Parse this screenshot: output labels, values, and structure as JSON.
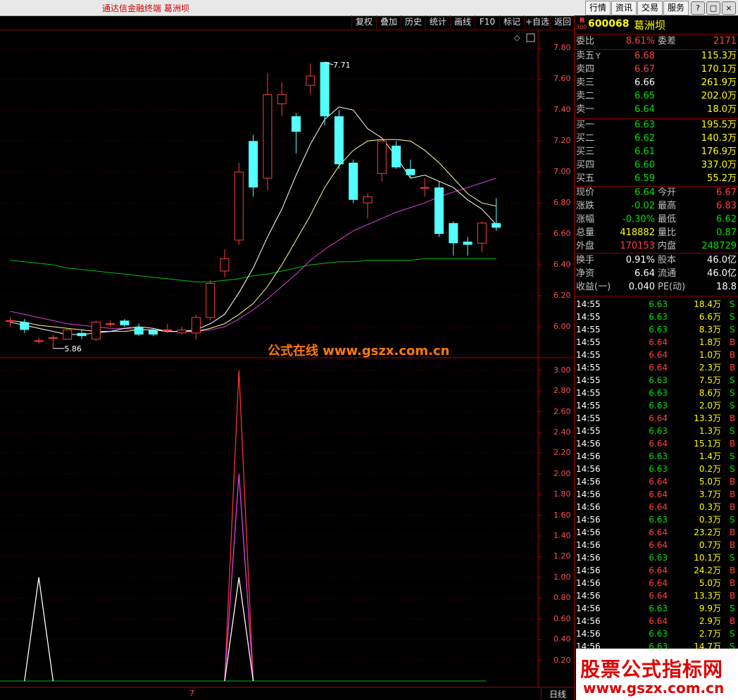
{
  "app": {
    "title": "通达信金融终端  葛洲坝"
  },
  "top_buttons": [
    "行情",
    "资讯",
    "交易",
    "服务"
  ],
  "window_buttons": [
    "?",
    "□",
    "×"
  ],
  "toolbar": [
    "复权",
    "叠加",
    "历史",
    "统计",
    "画线",
    "F10",
    "标记",
    "+自选",
    "返回"
  ],
  "watermark": "公式在线  www.gszx.com.cn",
  "logo": {
    "cn": "股票公式指标网",
    "url": "www.gszx.com.cn"
  },
  "bottom": {
    "period_label": "日线",
    "date_marker": "7"
  },
  "stock": {
    "r_badge": "R",
    "r_sub": "300",
    "code": "600068",
    "name": "葛洲坝"
  },
  "weibi": {
    "label1": "委比",
    "value1": "8.61%",
    "label2": "委差",
    "value2": "2171"
  },
  "sell_orders": [
    {
      "label": "卖五",
      "flag": "Y",
      "price": "6.68",
      "vol": "115.3万"
    },
    {
      "label": "卖四",
      "flag": "",
      "price": "6.67",
      "vol": "170.1万"
    },
    {
      "label": "卖三",
      "flag": "",
      "price": "6.66",
      "vol": "261.9万"
    },
    {
      "label": "卖二",
      "flag": "",
      "price": "6.65",
      "vol": "202.0万"
    },
    {
      "label": "卖一",
      "flag": "",
      "price": "6.64",
      "vol": "18.0万"
    }
  ],
  "buy_orders": [
    {
      "label": "买一",
      "price": "6.63",
      "vol": "195.5万"
    },
    {
      "label": "买二",
      "price": "6.62",
      "vol": "140.3万"
    },
    {
      "label": "买三",
      "price": "6.61",
      "vol": "176.9万"
    },
    {
      "label": "买四",
      "price": "6.60",
      "vol": "337.0万"
    },
    {
      "label": "买五",
      "price": "6.59",
      "vol": "55.2万"
    }
  ],
  "stats": [
    {
      "l1": "现价",
      "v1": "6.64",
      "c1": "green",
      "l2": "今开",
      "v2": "6.67",
      "c2": "red"
    },
    {
      "l1": "涨跌",
      "v1": "-0.02",
      "c1": "green",
      "l2": "最高",
      "v2": "6.83",
      "c2": "red"
    },
    {
      "l1": "涨幅",
      "v1": "-0.30%",
      "c1": "green",
      "l2": "最低",
      "v2": "6.62",
      "c2": "green"
    },
    {
      "l1": "总量",
      "v1": "418882",
      "c1": "yellow",
      "l2": "量比",
      "v2": "0.87",
      "c2": "green"
    },
    {
      "l1": "外盘",
      "v1": "170153",
      "c1": "red",
      "l2": "内盘",
      "v2": "248729",
      "c2": "green"
    }
  ],
  "finance": [
    {
      "l1": "换手",
      "v1": "0.91%",
      "l2": "股本",
      "v2": "46.0亿"
    },
    {
      "l1": "净资",
      "v1": "6.64",
      "l2": "流通",
      "v2": "46.0亿"
    },
    {
      "l1": "收益(一)",
      "v1": "0.040",
      "l2": "PE(动)",
      "v2": "18.8"
    }
  ],
  "ticks": [
    {
      "t": "14:55",
      "p": "6.63",
      "v": "18.4万",
      "s": "S"
    },
    {
      "t": "14:55",
      "p": "6.63",
      "v": "6.6万",
      "s": "S"
    },
    {
      "t": "14:55",
      "p": "6.63",
      "v": "8.3万",
      "s": "S"
    },
    {
      "t": "14:55",
      "p": "6.64",
      "v": "1.8万",
      "s": "B"
    },
    {
      "t": "14:55",
      "p": "6.64",
      "v": "1.0万",
      "s": "B"
    },
    {
      "t": "14:55",
      "p": "6.64",
      "v": "2.3万",
      "s": "B"
    },
    {
      "t": "14:55",
      "p": "6.63",
      "v": "7.5万",
      "s": "S"
    },
    {
      "t": "14:55",
      "p": "6.63",
      "v": "8.6万",
      "s": "S"
    },
    {
      "t": "14:55",
      "p": "6.63",
      "v": "2.0万",
      "s": "S"
    },
    {
      "t": "14:55",
      "p": "6.64",
      "v": "13.3万",
      "s": "B"
    },
    {
      "t": "14:55",
      "p": "6.63",
      "v": "1.3万",
      "s": "S"
    },
    {
      "t": "14:56",
      "p": "6.64",
      "v": "15.1万",
      "s": "B"
    },
    {
      "t": "14:56",
      "p": "6.63",
      "v": "1.4万",
      "s": "S"
    },
    {
      "t": "14:56",
      "p": "6.63",
      "v": "0.2万",
      "s": "S"
    },
    {
      "t": "14:56",
      "p": "6.64",
      "v": "5.0万",
      "s": "B"
    },
    {
      "t": "14:56",
      "p": "6.64",
      "v": "3.7万",
      "s": "B"
    },
    {
      "t": "14:56",
      "p": "6.64",
      "v": "0.3万",
      "s": "B"
    },
    {
      "t": "14:56",
      "p": "6.63",
      "v": "0.3万",
      "s": "S"
    },
    {
      "t": "14:56",
      "p": "6.64",
      "v": "23.2万",
      "s": "B"
    },
    {
      "t": "14:56",
      "p": "6.64",
      "v": "0.7万",
      "s": "B"
    },
    {
      "t": "14:56",
      "p": "6.63",
      "v": "10.1万",
      "s": "S"
    },
    {
      "t": "14:56",
      "p": "6.64",
      "v": "24.2万",
      "s": "B"
    },
    {
      "t": "14:56",
      "p": "6.64",
      "v": "5.0万",
      "s": "B"
    },
    {
      "t": "14:56",
      "p": "6.64",
      "v": "13.3万",
      "s": "B"
    },
    {
      "t": "14:56",
      "p": "6.63",
      "v": "9.9万",
      "s": "S"
    },
    {
      "t": "14:56",
      "p": "6.64",
      "v": "2.9万",
      "s": "B"
    },
    {
      "t": "14:56",
      "p": "6.63",
      "v": "2.7万",
      "s": "S"
    },
    {
      "t": "14:56",
      "p": "6.63",
      "v": "14.7万",
      "s": "S"
    }
  ],
  "chart_data": [
    {
      "type": "candlestick",
      "y_ticks": [
        "7.80",
        "7.60",
        "7.40",
        "7.20",
        "7.00",
        "6.80",
        "6.60",
        "6.40",
        "6.20",
        "6.00"
      ],
      "ylim": [
        5.8,
        7.92
      ],
      "max_label": "7.71",
      "min_label": "5.86",
      "candles": [
        {
          "o": 6.04,
          "c": 6.04,
          "h": 6.06,
          "l": 6.0
        },
        {
          "o": 6.03,
          "c": 5.98,
          "h": 6.05,
          "l": 5.96
        },
        {
          "o": 5.91,
          "c": 5.91,
          "h": 5.93,
          "l": 5.89
        },
        {
          "o": 5.93,
          "c": 5.93,
          "h": 5.95,
          "l": 5.86
        },
        {
          "o": 5.92,
          "c": 5.98,
          "h": 5.99,
          "l": 5.92
        },
        {
          "o": 5.96,
          "c": 5.94,
          "h": 5.98,
          "l": 5.92
        },
        {
          "o": 5.92,
          "c": 6.03,
          "h": 6.04,
          "l": 5.91
        },
        {
          "o": 6.02,
          "c": 6.02,
          "h": 6.04,
          "l": 6.0
        },
        {
          "o": 6.04,
          "c": 6.01,
          "h": 6.05,
          "l": 6.0
        },
        {
          "o": 6.0,
          "c": 5.95,
          "h": 6.02,
          "l": 5.94
        },
        {
          "o": 5.98,
          "c": 5.95,
          "h": 5.99,
          "l": 5.94
        },
        {
          "o": 5.98,
          "c": 5.98,
          "h": 6.02,
          "l": 5.96
        },
        {
          "o": 5.96,
          "c": 5.98,
          "h": 6.0,
          "l": 5.95
        },
        {
          "o": 5.96,
          "c": 6.06,
          "h": 6.08,
          "l": 5.92
        },
        {
          "o": 6.06,
          "c": 6.28,
          "h": 6.3,
          "l": 6.04
        },
        {
          "o": 6.36,
          "c": 6.44,
          "h": 6.5,
          "l": 6.32
        },
        {
          "o": 6.56,
          "c": 7.0,
          "h": 7.06,
          "l": 6.53
        },
        {
          "o": 7.2,
          "c": 6.9,
          "h": 7.24,
          "l": 6.84
        },
        {
          "o": 6.96,
          "c": 7.5,
          "h": 7.64,
          "l": 6.88
        },
        {
          "o": 7.44,
          "c": 7.5,
          "h": 7.58,
          "l": 7.36
        },
        {
          "o": 7.36,
          "c": 7.26,
          "h": 7.38,
          "l": 7.12
        },
        {
          "o": 7.56,
          "c": 7.62,
          "h": 7.7,
          "l": 7.5
        },
        {
          "o": 7.71,
          "c": 7.36,
          "h": 7.71,
          "l": 7.3
        },
        {
          "o": 7.36,
          "c": 7.05,
          "h": 7.4,
          "l": 7.02
        },
        {
          "o": 7.06,
          "c": 6.82,
          "h": 7.08,
          "l": 6.8
        },
        {
          "o": 6.8,
          "c": 6.84,
          "h": 6.86,
          "l": 6.7
        },
        {
          "o": 6.99,
          "c": 7.2,
          "h": 7.22,
          "l": 6.94
        },
        {
          "o": 7.17,
          "c": 7.03,
          "h": 7.2,
          "l": 7.02
        },
        {
          "o": 7.02,
          "c": 6.98,
          "h": 7.08,
          "l": 6.96
        },
        {
          "o": 6.9,
          "c": 6.9,
          "h": 6.96,
          "l": 6.84
        },
        {
          "o": 6.9,
          "c": 6.6,
          "h": 6.94,
          "l": 6.58
        },
        {
          "o": 6.67,
          "c": 6.54,
          "h": 6.68,
          "l": 6.46
        },
        {
          "o": 6.55,
          "c": 6.53,
          "h": 6.58,
          "l": 6.46
        },
        {
          "o": 6.54,
          "c": 6.67,
          "h": 6.68,
          "l": 6.48
        },
        {
          "o": 6.67,
          "c": 6.64,
          "h": 6.83,
          "l": 6.62
        }
      ],
      "ma_white": [
        6.03,
        6.01,
        5.99,
        5.97,
        5.95,
        5.95,
        5.96,
        5.97,
        5.99,
        6.0,
        5.99,
        5.97,
        5.97,
        5.98,
        6.02,
        6.08,
        6.22,
        6.38,
        6.58,
        6.76,
        6.98,
        7.18,
        7.34,
        7.42,
        7.4,
        7.28,
        7.22,
        7.1,
        6.96,
        6.98,
        6.94,
        6.9,
        6.82,
        6.76,
        6.66
      ],
      "ma_yellow": [
        6.04,
        6.03,
        6.01,
        6.0,
        5.99,
        5.98,
        5.97,
        5.97,
        5.97,
        5.98,
        5.98,
        5.97,
        5.97,
        5.97,
        5.99,
        6.02,
        6.08,
        6.15,
        6.26,
        6.4,
        6.56,
        6.72,
        6.9,
        7.04,
        7.14,
        7.2,
        7.21,
        7.21,
        7.2,
        7.14,
        7.06,
        6.96,
        6.86,
        6.8,
        6.78
      ],
      "ma_magenta": [
        6.1,
        6.08,
        6.06,
        6.04,
        6.02,
        6.01,
        6.0,
        5.99,
        5.99,
        5.98,
        5.98,
        5.97,
        5.97,
        5.97,
        5.98,
        6.0,
        6.05,
        6.11,
        6.18,
        6.26,
        6.34,
        6.43,
        6.5,
        6.56,
        6.62,
        6.66,
        6.7,
        6.74,
        6.77,
        6.8,
        6.84,
        6.87,
        6.9,
        6.93,
        6.96
      ],
      "ma_green": [
        6.43,
        6.42,
        6.41,
        6.4,
        6.38,
        6.37,
        6.36,
        6.35,
        6.34,
        6.33,
        6.32,
        6.31,
        6.3,
        6.29,
        6.29,
        6.3,
        6.31,
        6.33,
        6.34,
        6.36,
        6.38,
        6.4,
        6.41,
        6.42,
        6.42,
        6.43,
        6.43,
        6.43,
        6.43,
        6.44,
        6.44,
        6.44,
        6.44,
        6.44,
        6.44
      ]
    },
    {
      "type": "line",
      "y_ticks": [
        "3.00",
        "2.80",
        "2.60",
        "2.40",
        "2.20",
        "2.00",
        "1.80",
        "1.60",
        "1.40",
        "1.20",
        "1.00",
        "0.80",
        "0.60",
        "0.40",
        "0.20"
      ],
      "ylim": [
        0,
        3.12
      ],
      "series": [
        {
          "color": "#ff3030",
          "points": [
            {
              "i": 15,
              "v": 0
            },
            {
              "i": 16,
              "v": 3.0
            },
            {
              "i": 17,
              "v": 0
            }
          ]
        },
        {
          "color": "#e040e0",
          "points": [
            {
              "i": 15,
              "v": 0
            },
            {
              "i": 16,
              "v": 2.0
            },
            {
              "i": 17,
              "v": 0
            }
          ]
        },
        {
          "color": "#ffffff",
          "points": [
            {
              "i": 1,
              "v": 0
            },
            {
              "i": 2,
              "v": 1.0
            },
            {
              "i": 3,
              "v": 0
            }
          ]
        },
        {
          "color": "#ffffff",
          "points": [
            {
              "i": 15,
              "v": 0
            },
            {
              "i": 16,
              "v": 1.0
            },
            {
              "i": 17,
              "v": 0
            }
          ]
        }
      ]
    }
  ]
}
